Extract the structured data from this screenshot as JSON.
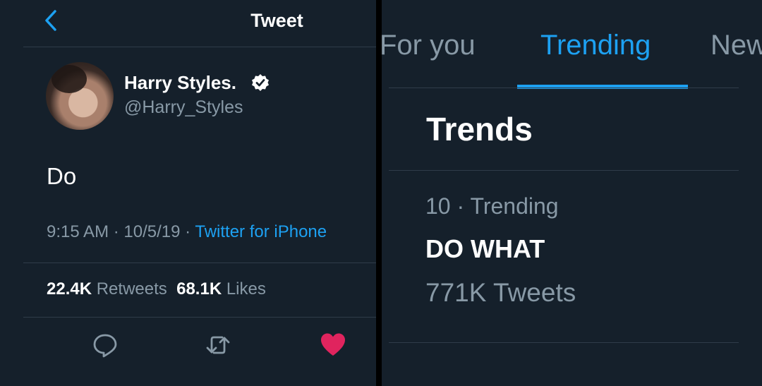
{
  "tweet_view": {
    "header": {
      "title": "Tweet"
    },
    "author": {
      "name": "Harry Styles.",
      "handle": "@Harry_Styles"
    },
    "tweet": {
      "text": "Do",
      "timestamp": "9:15 AM · 10/5/19 · ",
      "source": "Twitter for iPhone"
    },
    "stats": {
      "retweets_count": "22.4K",
      "retweets_label": "Retweets",
      "likes_count": "68.1K",
      "likes_label": "Likes"
    },
    "colors": {
      "background": "#15202b",
      "accent": "#1da1f2",
      "like": "#e0245e"
    },
    "icons": [
      "chevron-left-icon",
      "verified-badge-icon",
      "reply-icon",
      "retweet-icon",
      "heart-icon"
    ]
  },
  "explore_view": {
    "tabs": [
      {
        "label": "For you"
      },
      {
        "label": "Trending"
      },
      {
        "label": "News"
      }
    ],
    "active_tab": "Trending",
    "section_title": "Trends",
    "trend": {
      "meta": "10 · Trending",
      "name": "DO WHAT",
      "count": "771K Tweets"
    }
  }
}
